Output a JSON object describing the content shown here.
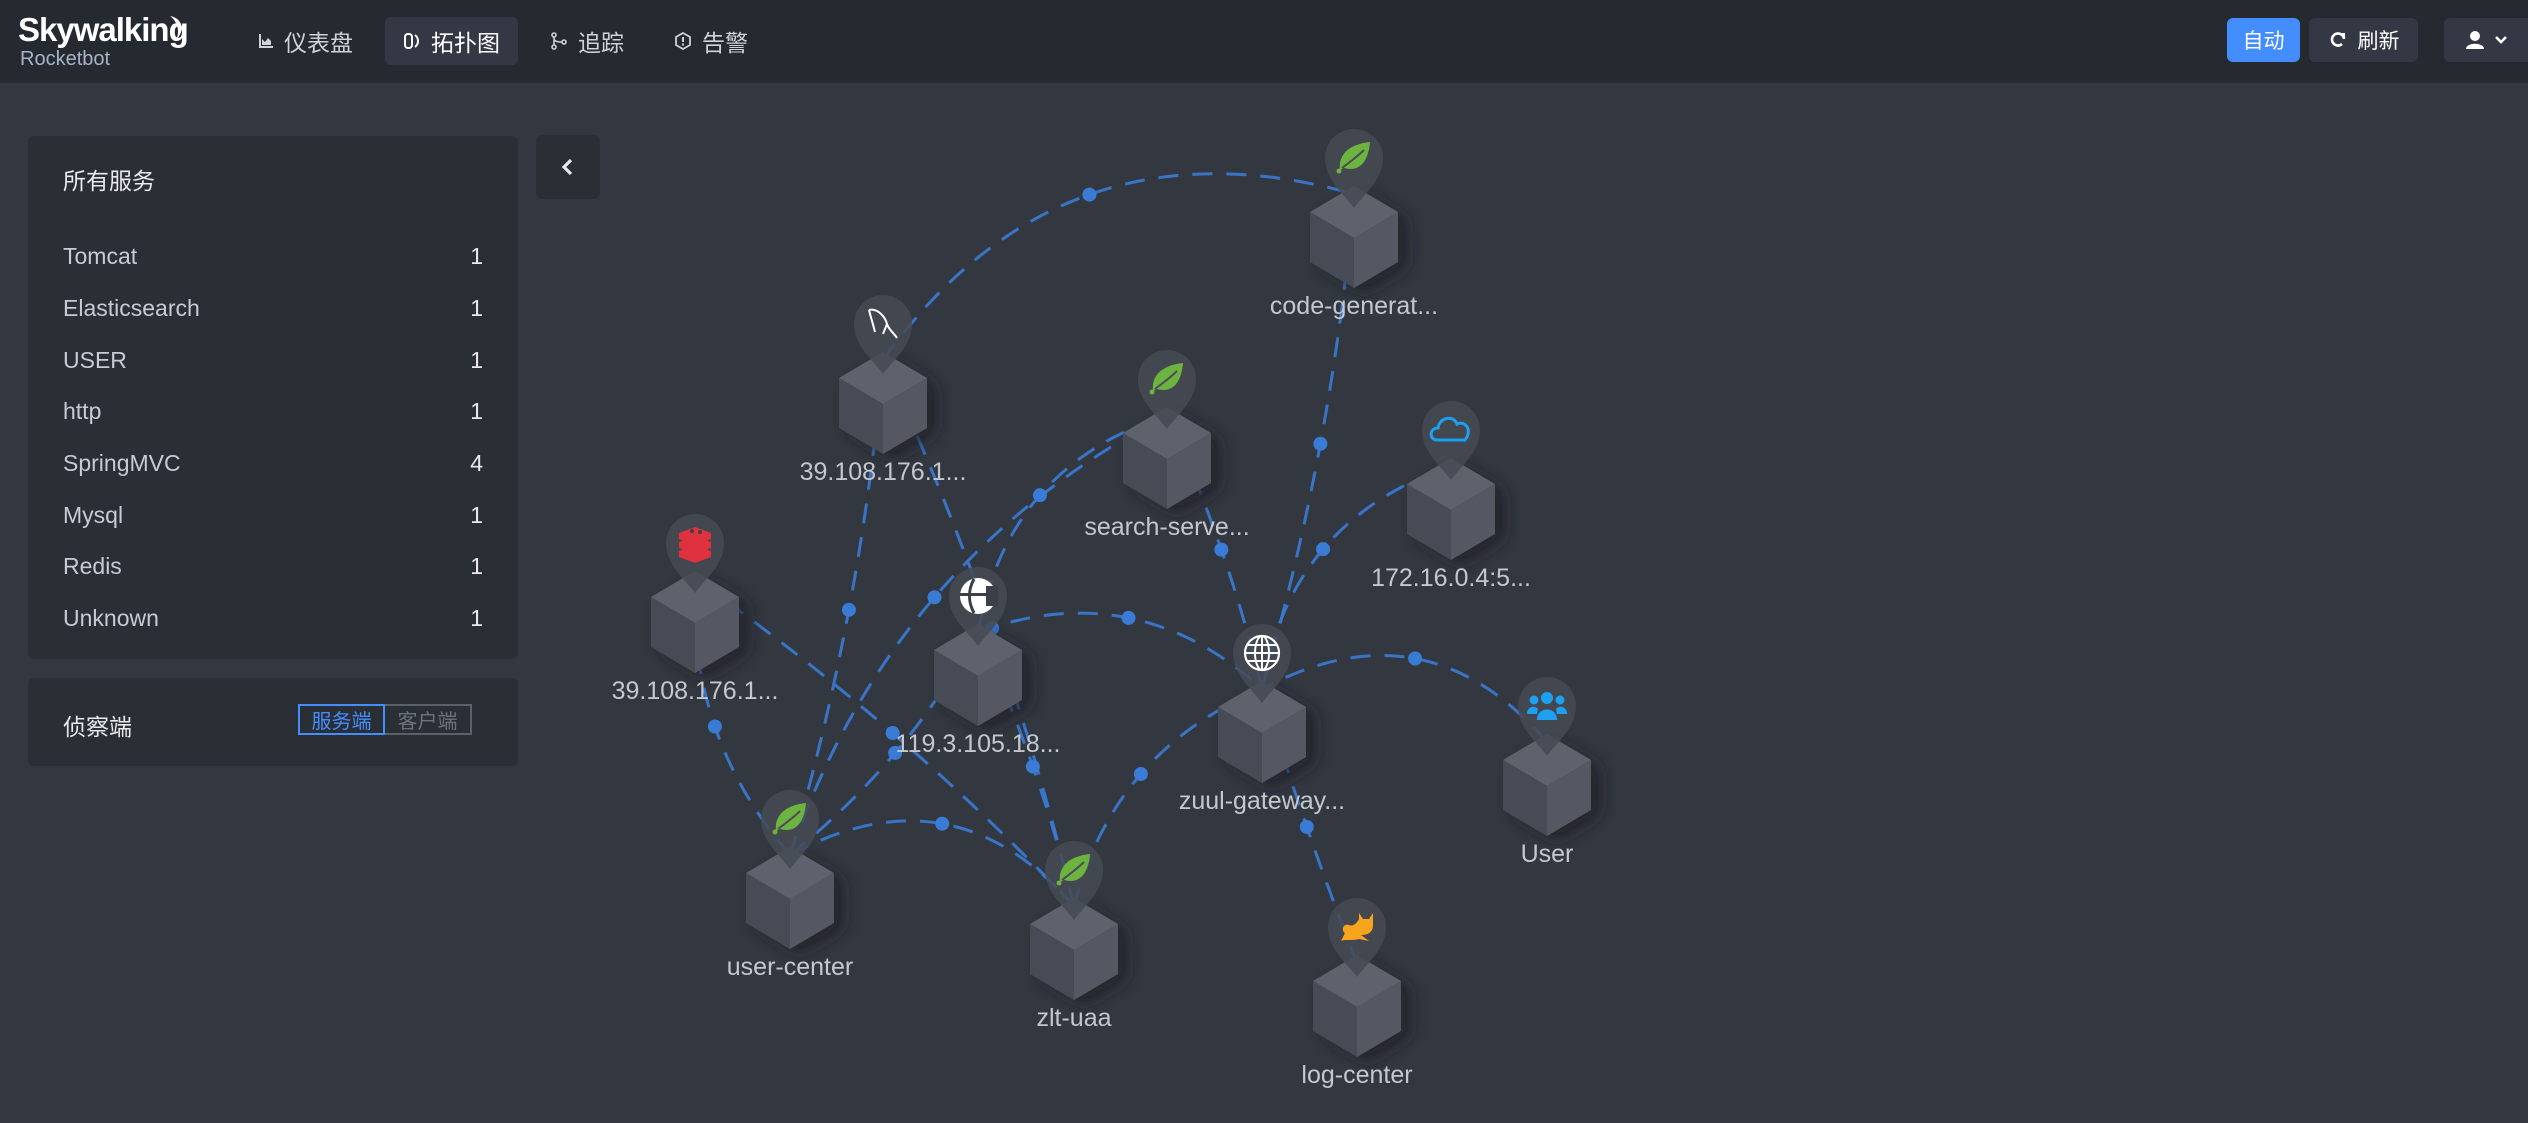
{
  "header": {
    "logo_title": "Skywalking",
    "logo_subtitle": "Rocketbot",
    "nav": [
      {
        "label": "仪表盘",
        "icon": "chart-icon",
        "active": false
      },
      {
        "label": "拓扑图",
        "icon": "topology-icon",
        "active": true
      },
      {
        "label": "追踪",
        "icon": "trace-icon",
        "active": false
      },
      {
        "label": "告警",
        "icon": "alarm-icon",
        "active": false
      }
    ],
    "auto_label": "自动",
    "refresh_label": "刷新",
    "user_icon": "user-icon"
  },
  "services_panel": {
    "title": "所有服务",
    "items": [
      {
        "name": "Tomcat",
        "count": "1"
      },
      {
        "name": "Elasticsearch",
        "count": "1"
      },
      {
        "name": "USER",
        "count": "1"
      },
      {
        "name": "http",
        "count": "1"
      },
      {
        "name": "SpringMVC",
        "count": "4"
      },
      {
        "name": "Mysql",
        "count": "1"
      },
      {
        "name": "Redis",
        "count": "1"
      },
      {
        "name": "Unknown",
        "count": "1"
      }
    ]
  },
  "detect_panel": {
    "label": "侦察端",
    "options": [
      "服务端",
      "客户端"
    ],
    "selected": "服务端"
  },
  "colors": {
    "accent": "#448dfe",
    "edge": "#3a7bd5",
    "spring": "#6db33f",
    "redis": "#e0313f",
    "tomcat": "#f8a51d",
    "cloud": "#1ea0f0",
    "user": "#1ea0f0"
  },
  "topology": {
    "nodes": [
      {
        "id": "code-generator",
        "label": "code-generat...",
        "type": "SpringMVC",
        "icon": "spring-leaf-icon"
      },
      {
        "id": "mysql",
        "label": "39.108.176.1...",
        "type": "Mysql",
        "icon": "mysql-dolphin-icon"
      },
      {
        "id": "search-server",
        "label": "search-serve...",
        "type": "SpringMVC",
        "icon": "spring-leaf-icon"
      },
      {
        "id": "cloud-172",
        "label": "172.16.0.4:5...",
        "type": "Unknown",
        "icon": "cloud-icon"
      },
      {
        "id": "redis",
        "label": "39.108.176.1...",
        "type": "Redis",
        "icon": "redis-icon"
      },
      {
        "id": "elasticsearch",
        "label": "119.3.105.18...",
        "type": "Elasticsearch",
        "icon": "elasticsearch-icon"
      },
      {
        "id": "zuul-gateway",
        "label": "zuul-gateway...",
        "type": "http",
        "icon": "globe-icon"
      },
      {
        "id": "user",
        "label": "User",
        "type": "USER",
        "icon": "users-icon"
      },
      {
        "id": "user-center",
        "label": "user-center",
        "type": "SpringMVC",
        "icon": "spring-leaf-icon"
      },
      {
        "id": "zlt-uaa",
        "label": "zlt-uaa",
        "type": "SpringMVC",
        "icon": "spring-leaf-icon"
      },
      {
        "id": "log-center",
        "label": "log-center",
        "type": "Tomcat",
        "icon": "tomcat-icon"
      }
    ],
    "edges": [
      {
        "source": "mysql",
        "target": "code-generator"
      },
      {
        "source": "zuul-gateway",
        "target": "code-generator"
      },
      {
        "source": "user-center",
        "target": "mysql"
      },
      {
        "source": "zlt-uaa",
        "target": "mysql"
      },
      {
        "source": "elasticsearch",
        "target": "search-server"
      },
      {
        "source": "zuul-gateway",
        "target": "search-server"
      },
      {
        "source": "zuul-gateway",
        "target": "cloud-172"
      },
      {
        "source": "user-center",
        "target": "redis"
      },
      {
        "source": "zlt-uaa",
        "target": "redis"
      },
      {
        "source": "user-center",
        "target": "elasticsearch"
      },
      {
        "source": "zlt-uaa",
        "target": "elasticsearch"
      },
      {
        "source": "user-center",
        "target": "search-server"
      },
      {
        "source": "elasticsearch",
        "target": "zuul-gateway"
      },
      {
        "source": "zlt-uaa",
        "target": "zuul-gateway"
      },
      {
        "source": "user",
        "target": "zuul-gateway"
      },
      {
        "source": "zuul-gateway",
        "target": "log-center"
      },
      {
        "source": "user-center",
        "target": "zlt-uaa"
      }
    ]
  }
}
